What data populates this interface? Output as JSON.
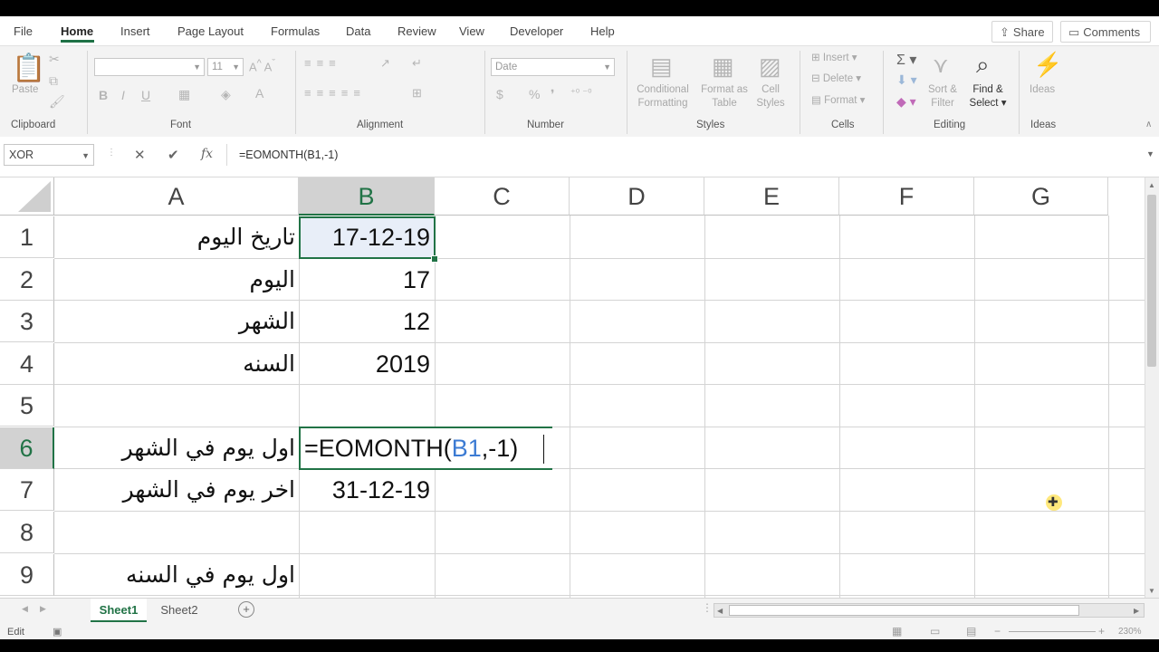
{
  "menu": {
    "items": [
      "File",
      "Home",
      "Insert",
      "Page Layout",
      "Formulas",
      "Data",
      "Review",
      "View",
      "Developer",
      "Help"
    ],
    "active": "Home",
    "share_label": "Share",
    "comments_label": "Comments"
  },
  "ribbon": {
    "clipboard": {
      "label": "Clipboard",
      "paste": "Paste"
    },
    "font": {
      "label": "Font",
      "size": "11",
      "bold": "B",
      "italic": "I",
      "underline": "U"
    },
    "alignment": {
      "label": "Alignment"
    },
    "number": {
      "label": "Number",
      "format": "Date",
      "currency": "$",
      "percent": "%"
    },
    "styles": {
      "label": "Styles",
      "conditional": [
        "Conditional",
        "Formatting"
      ],
      "format_table": [
        "Format as",
        "Table"
      ],
      "cell_styles": [
        "Cell",
        "Styles"
      ]
    },
    "cells": {
      "label": "Cells",
      "insert": "Insert",
      "delete": "Delete",
      "format": "Format"
    },
    "editing": {
      "label": "Editing",
      "sort": [
        "Sort &",
        "Filter"
      ],
      "find": [
        "Find &",
        "Select"
      ]
    },
    "ideas": {
      "label": "Ideas",
      "button": "Ideas"
    }
  },
  "formula_bar": {
    "name_box": "XOR",
    "cancel": "✕",
    "enter": "✔",
    "fx": "fx",
    "content": "=EOMONTH(B1,-1)"
  },
  "columns": [
    "A",
    "B",
    "C",
    "D",
    "E",
    "F",
    "G"
  ],
  "selected_column": "B",
  "rows": [
    "1",
    "2",
    "3",
    "4",
    "5",
    "6",
    "7",
    "8",
    "9"
  ],
  "selected_row": "6",
  "cells": {
    "A1": "تاريخ اليوم",
    "B1": "17-12-19",
    "A2": "اليوم",
    "B2": "17",
    "A3": "الشهر",
    "B3": "12",
    "A4": "السنه",
    "B4": "2019",
    "A6": "اول يوم في الشهر",
    "A7": "اخر يوم في الشهر",
    "B7": "31-12-19",
    "A9": "اول يوم في السنه"
  },
  "editing_cell": {
    "prefix": "=EOMONTH(",
    "ref": "B1",
    "suffix": ",-1)"
  },
  "sheets": {
    "tabs": [
      "Sheet1",
      "Sheet2"
    ],
    "active": "Sheet1"
  },
  "status": {
    "mode": "Edit",
    "zoom": "230%"
  },
  "colors": {
    "accent": "#217346",
    "ref_blue": "#3c7bd3",
    "selection_fill": "#e8eef8"
  }
}
